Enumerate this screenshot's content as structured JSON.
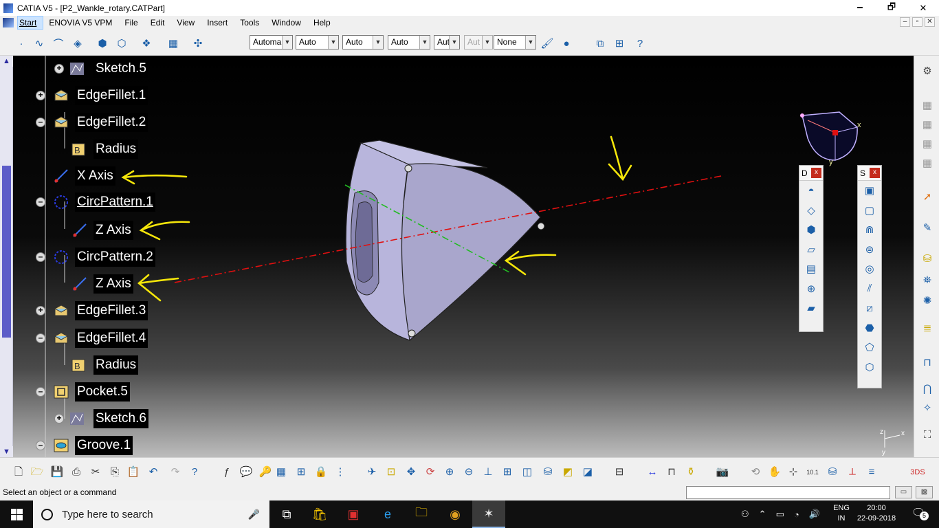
{
  "window": {
    "title": "CATIA V5 - [P2_Wankle_rotary.CATPart]",
    "minimize": "🗕",
    "restore": "🗗",
    "close": "✕"
  },
  "menu": {
    "items": [
      "Start",
      "ENOVIA V5 VPM",
      "File",
      "Edit",
      "View",
      "Insert",
      "Tools",
      "Window",
      "Help"
    ],
    "mdi": [
      "–",
      "▫",
      "✕"
    ]
  },
  "toolbar": {
    "combos": [
      {
        "value": "Automa",
        "disabled": false
      },
      {
        "value": "Auto",
        "disabled": false
      },
      {
        "value": "Auto",
        "disabled": false
      },
      {
        "value": "Auto",
        "disabled": false
      },
      {
        "value": "Aut",
        "disabled": false
      },
      {
        "value": "Aut",
        "disabled": true
      },
      {
        "value": "None",
        "disabled": false
      }
    ]
  },
  "tree": {
    "items": [
      {
        "label": "Sketch.5",
        "icon": "sketch-icon",
        "level": 2,
        "expander": "+"
      },
      {
        "label": "EdgeFillet.1",
        "icon": "edge-fillet-icon",
        "level": 1,
        "expander": "+"
      },
      {
        "label": "EdgeFillet.2",
        "icon": "edge-fillet-icon",
        "level": 1,
        "expander": "–"
      },
      {
        "label": "Radius",
        "icon": "radius-parameter-icon",
        "level": 2,
        "expander": ""
      },
      {
        "label": "X Axis",
        "icon": "axis-icon",
        "level": 1,
        "expander": ""
      },
      {
        "label": "CircPattern.1",
        "icon": "circular-pattern-icon",
        "level": 1,
        "expander": "–",
        "underline": true
      },
      {
        "label": "Z Axis",
        "icon": "axis-icon",
        "level": 2,
        "expander": ""
      },
      {
        "label": "CircPattern.2",
        "icon": "circular-pattern-icon",
        "level": 1,
        "expander": "–"
      },
      {
        "label": "Z Axis",
        "icon": "axis-icon",
        "level": 2,
        "expander": ""
      },
      {
        "label": "EdgeFillet.3",
        "icon": "edge-fillet-icon",
        "level": 1,
        "expander": "+"
      },
      {
        "label": "EdgeFillet.4",
        "icon": "edge-fillet-icon",
        "level": 1,
        "expander": "–"
      },
      {
        "label": "Radius",
        "icon": "radius-parameter-icon",
        "level": 2,
        "expander": ""
      },
      {
        "label": "Pocket.5",
        "icon": "pocket-icon",
        "level": 1,
        "expander": "–"
      },
      {
        "label": "Sketch.6",
        "icon": "sketch-icon",
        "level": 2,
        "expander": "+"
      },
      {
        "label": "Groove.1",
        "icon": "groove-icon",
        "level": 1,
        "expander": "–"
      }
    ]
  },
  "compass_labels": {
    "x": "x",
    "y": "y"
  },
  "axis_triad": {
    "x": "x",
    "y": "y",
    "z": "z"
  },
  "floating_toolbars": [
    {
      "title": "D",
      "close": "x"
    },
    {
      "title": "S",
      "close": "x"
    }
  ],
  "status": {
    "message": "Select an object or a command"
  },
  "taskbar": {
    "search_placeholder": "Type here to search",
    "lang_line1": "ENG",
    "lang_line2": "IN",
    "time": "20:00",
    "date": "22-09-2018",
    "notifications": "5"
  },
  "colors": {
    "annotation_arrow": "#f5e60a",
    "axis_line": "#e01010",
    "axis_line_2": "#22bb22",
    "part_face": "#a9a6cc"
  }
}
